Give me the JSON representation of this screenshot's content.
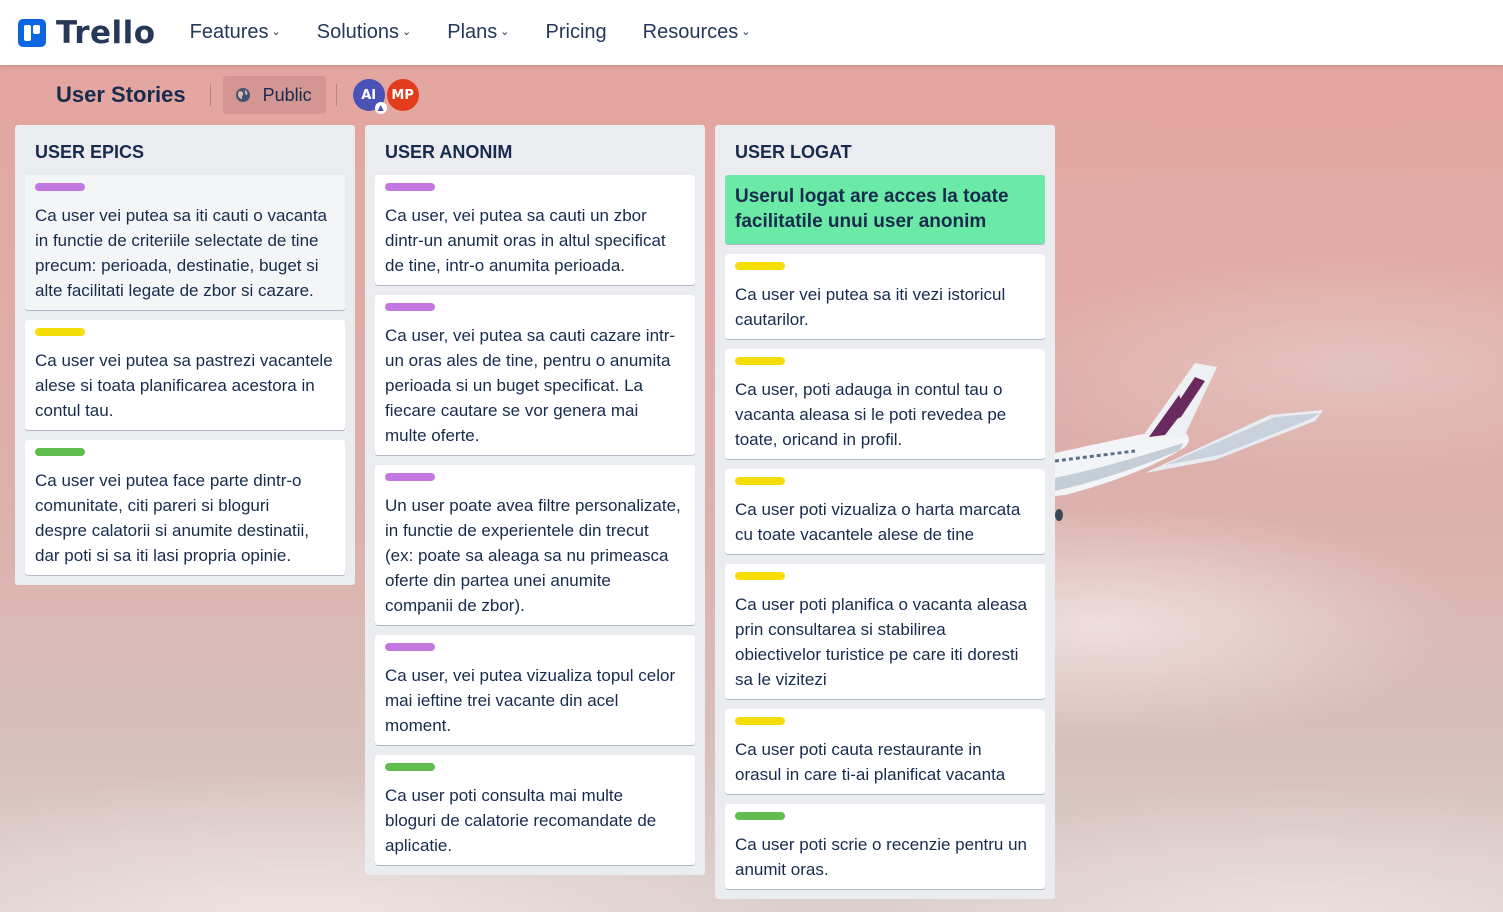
{
  "app": {
    "brand": "Trello",
    "brand_color": "#0c66e4",
    "nav": [
      {
        "label": "Features",
        "dropdown": true
      },
      {
        "label": "Solutions",
        "dropdown": true
      },
      {
        "label": "Plans",
        "dropdown": true
      },
      {
        "label": "Pricing",
        "dropdown": false
      },
      {
        "label": "Resources",
        "dropdown": true
      }
    ]
  },
  "board": {
    "title": "User Stories",
    "visibility": "Public",
    "members": [
      {
        "initials": "AI",
        "color": "#4b52b5",
        "admin": true
      },
      {
        "initials": "MP",
        "color": "#e23c1c",
        "admin": false
      }
    ]
  },
  "labels": {
    "purple": "#c377e0",
    "yellow": "#f5dd07",
    "green": "#61bd4f",
    "cover_green": "#6aeaa6"
  },
  "lists": [
    {
      "title": "USER EPICS",
      "cards": [
        {
          "label": "purple",
          "text": "Ca user vei putea sa iti cauti o vacanta\nin functie de criteriile selectate de tine\nprecum: perioada, destinatie, buget si\nalte facilitati legate de zbor si cazare."
        },
        {
          "label": "yellow",
          "text": "Ca user vei putea sa pastrezi vacantele\nalese si toata planificarea acestora in\ncontul tau."
        },
        {
          "label": "green",
          "text": "Ca user vei putea face parte dintr-o\ncomunitate, citi pareri si bloguri\ndespre calatorii si anumite destinatii,\ndar poti si sa iti lasi propria opinie."
        }
      ]
    },
    {
      "title": "USER ANONIM",
      "cards": [
        {
          "label": "purple",
          "text": "Ca user, vei putea sa cauti un zbor\ndintr-un anumit oras in altul specificat\nde tine, intr-o anumita perioada."
        },
        {
          "label": "purple",
          "text": "Ca user, vei putea sa cauti cazare intr-\nun oras ales de tine, pentru o anumita\nperioada si un buget specificat. La\nfiecare cautare se vor genera mai\nmulte oferte."
        },
        {
          "label": "purple",
          "text": "Un user poate avea filtre personalizate,\nin functie de experientele din trecut\n(ex: poate sa aleaga sa nu primeasca\noferte din partea unei anumite\ncompanii de zbor)."
        },
        {
          "label": "purple",
          "text": "Ca user, vei putea vizualiza topul celor\nmai ieftine trei vacante din acel\nmoment."
        },
        {
          "label": "green",
          "text": "Ca user poti consulta mai multe\nbloguri de calatorie recomandate de\naplicatie."
        }
      ]
    },
    {
      "title": "USER LOGAT",
      "cards": [
        {
          "label": null,
          "cover": true,
          "text": "Userul logat are acces la toate\nfacilitatile unui user anonim"
        },
        {
          "label": "yellow",
          "text": "Ca user vei putea sa iti vezi istoricul\ncautarilor."
        },
        {
          "label": "yellow",
          "text": "Ca user, poti adauga in contul tau o\nvacanta aleasa si le poti revedea pe\ntoate, oricand in profil."
        },
        {
          "label": "yellow",
          "text": "Ca user poti vizualiza o harta marcata\ncu toate vacantele alese de tine"
        },
        {
          "label": "yellow",
          "text": "Ca user poti planifica o vacanta aleasa\nprin consultarea si stabilirea\nobiectivelor turistice pe care iti doresti\nsa le vizitezi"
        },
        {
          "label": "yellow",
          "text": "Ca user poti cauta restaurante in\norasul in care ti-ai planificat vacanta"
        },
        {
          "label": "green",
          "text": "Ca user poti scrie o recenzie pentru un\nanumit oras."
        }
      ]
    }
  ]
}
